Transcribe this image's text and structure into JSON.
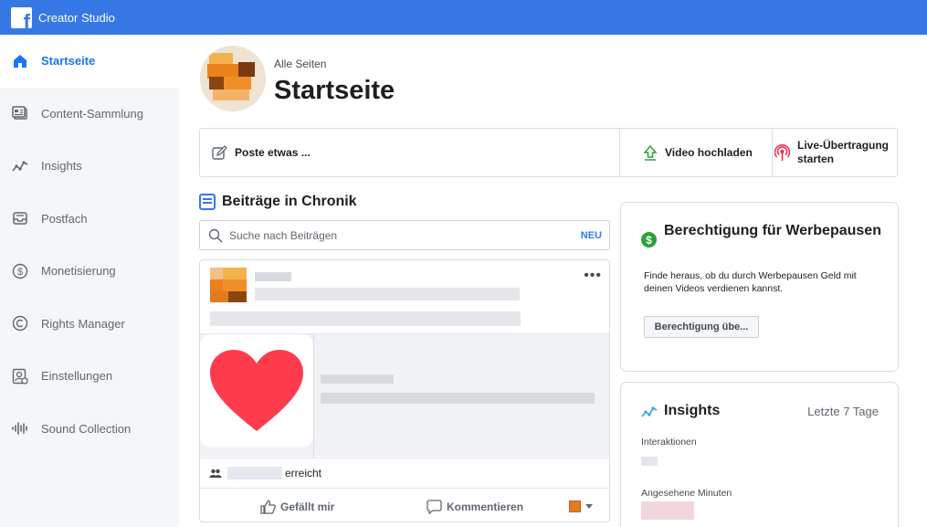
{
  "app": {
    "title": "Creator Studio",
    "logo_letter": "f"
  },
  "sidebar": {
    "items": [
      {
        "label": "Startseite",
        "icon": "home-icon",
        "active": true
      },
      {
        "label": "Content-Sammlung",
        "icon": "content-library-icon",
        "active": false
      },
      {
        "label": "Insights",
        "icon": "insights-icon",
        "active": false
      },
      {
        "label": "Postfach",
        "icon": "inbox-icon",
        "active": false
      },
      {
        "label": "Monetisierung",
        "icon": "dollar-icon",
        "active": false
      },
      {
        "label": "Rights Manager",
        "icon": "copyright-icon",
        "active": false
      },
      {
        "label": "Einstellungen",
        "icon": "settings-icon",
        "active": false
      },
      {
        "label": "Sound Collection",
        "icon": "sound-wave-icon",
        "active": false
      }
    ]
  },
  "header": {
    "breadcrumb": "Alle Seiten",
    "title": "Startseite"
  },
  "actions": {
    "post": "Poste etwas ...",
    "video": "Video hochladen",
    "live_line1": "Live-Übertragung",
    "live_line2": "starten"
  },
  "timeline": {
    "heading": "Beiträge in Chronik",
    "search_placeholder": "Suche nach Beiträgen",
    "new_badge": "NEU"
  },
  "post": {
    "more": "•••",
    "reach_suffix": "erreicht",
    "like_label": "Gefällt mir",
    "comment_label": "Kommentieren"
  },
  "ad_breaks": {
    "title": "Berechtigung für Werbepausen",
    "description": "Finde heraus, ob du durch Werbepausen Geld mit deinen Videos verdienen kannst.",
    "button": "Berechtigung übe..."
  },
  "insights": {
    "title": "Insights",
    "range": "Letzte 7 Tage",
    "metric1": "Interaktionen",
    "metric2": "Angesehene Minuten"
  },
  "colors": {
    "brand": "#3578e5",
    "active_nav": "#1877f2",
    "heart": "#ff3b4e",
    "dollar": "#2aa23c"
  }
}
